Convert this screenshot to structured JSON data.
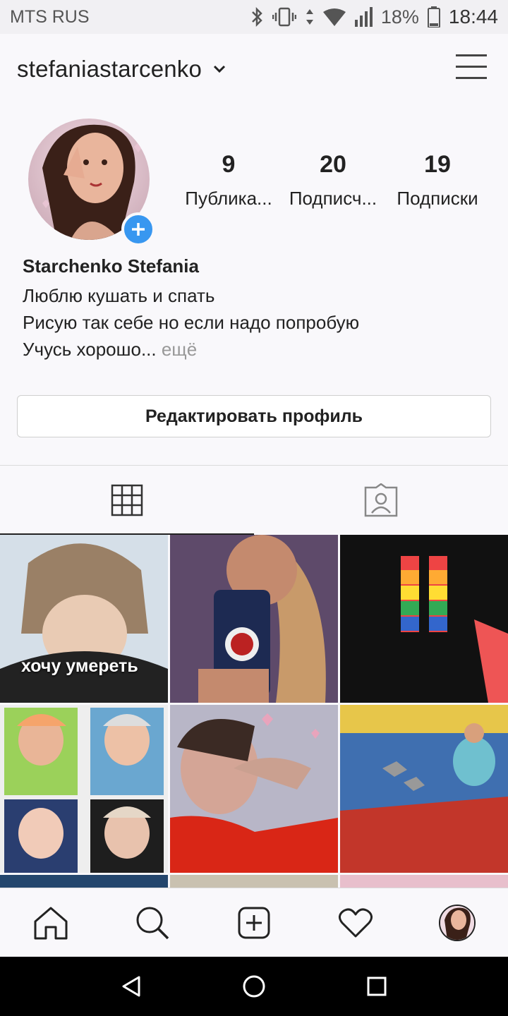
{
  "status_bar": {
    "carrier": "MTS RUS",
    "battery": "18%",
    "time": "18:44",
    "icons": [
      "bluetooth-icon",
      "vibrate-icon",
      "data-arrows-icon",
      "wifi-icon",
      "signal-icon",
      "battery-icon"
    ]
  },
  "header": {
    "username": "stefaniastarcenko",
    "icons": [
      "chevron-down-icon",
      "menu-icon"
    ]
  },
  "stats": [
    {
      "count": "9",
      "label": "Публика..."
    },
    {
      "count": "20",
      "label": "Подписч..."
    },
    {
      "count": "19",
      "label": "Подписки"
    }
  ],
  "bio": {
    "full_name": "Starchenko Stefania",
    "lines": [
      "Люблю кушать и спать",
      "Рисую так себе но если надо попробую",
      "Учусь хорошо..."
    ],
    "more": " ещё"
  },
  "edit_button": "Редактировать профиль",
  "tabs": [
    "grid-icon",
    "tagged-icon"
  ],
  "posts": [
    {
      "caption": "хочу умереть"
    }
  ],
  "bottom_nav": [
    "home-icon",
    "search-icon",
    "add-post-icon",
    "heart-icon",
    "profile-avatar"
  ],
  "colors": {
    "accent": "#3897f0",
    "text": "#222222"
  }
}
